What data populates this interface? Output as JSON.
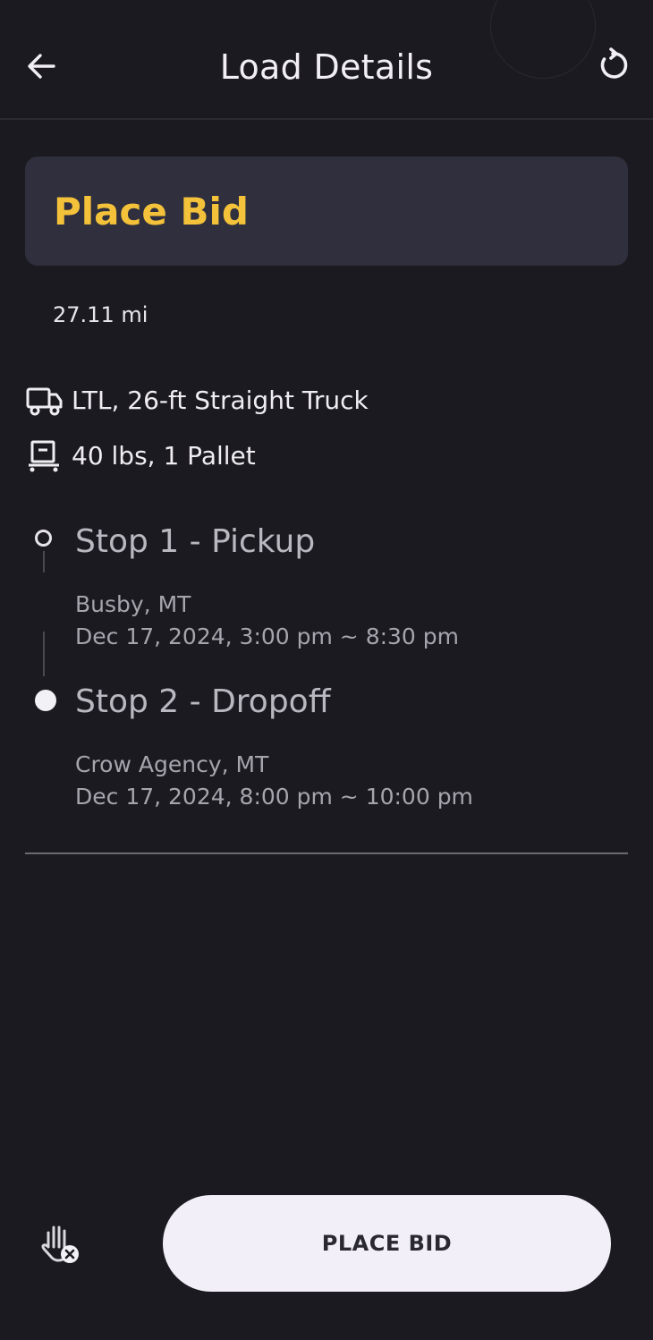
{
  "header": {
    "title": "Load Details",
    "back_icon": "arrow-left-icon",
    "refresh_icon": "refresh-icon"
  },
  "bid_card": {
    "title": "Place Bid"
  },
  "distance": "27.11 mi",
  "equipment": {
    "icon": "truck-icon",
    "text": "LTL, 26-ft Straight Truck"
  },
  "cargo": {
    "icon": "pallet-jack-icon",
    "text": "40 lbs, 1 Pallet"
  },
  "stops": [
    {
      "title": "Stop 1 - Pickup",
      "location": "Busby, MT",
      "time": "Dec 17, 2024, 3:00 pm ~ 8:30 pm"
    },
    {
      "title": "Stop 2 - Dropoff",
      "location": "Crow Agency, MT",
      "time": "Dec 17, 2024, 8:00 pm ~ 10:00 pm"
    }
  ],
  "footer": {
    "hand_icon": "hand-off-icon",
    "place_bid_label": "PLACE BID"
  },
  "colors": {
    "background": "#1b1a20",
    "card": "#2f2f3d",
    "accent": "#f3c23a",
    "button": "#f2eff8"
  }
}
